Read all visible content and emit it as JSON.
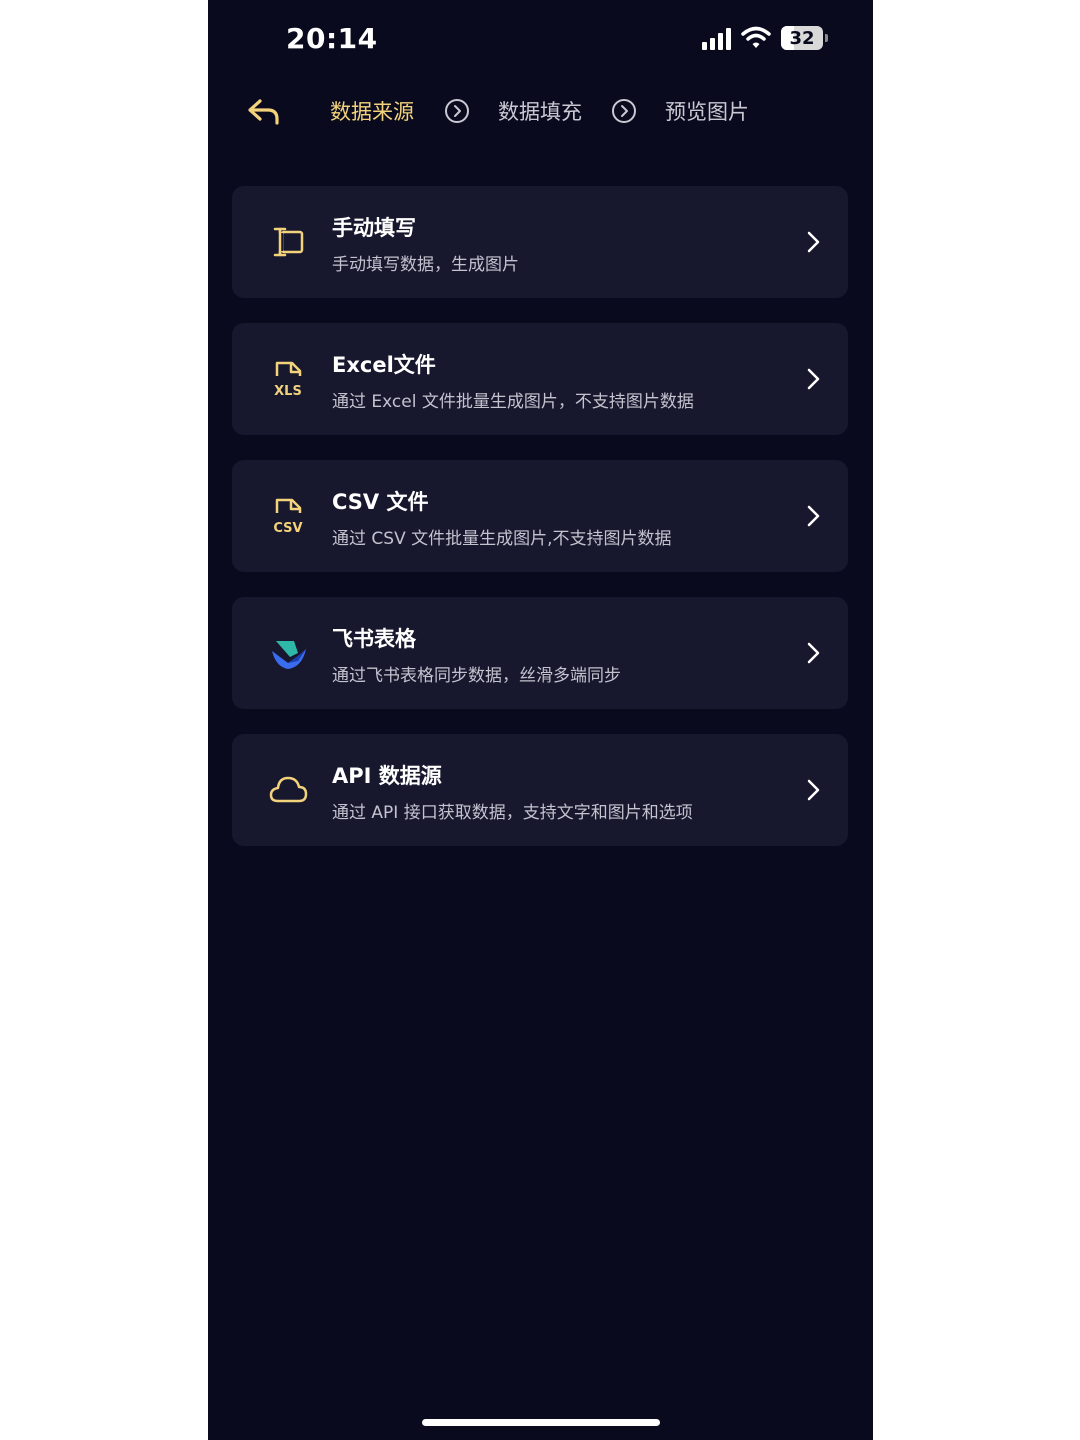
{
  "status_bar": {
    "time": "20:14",
    "battery": "32",
    "battery_level": 0.32,
    "icons": [
      "signal-icon",
      "wifi-icon",
      "battery-icon"
    ]
  },
  "steps": {
    "back_icon": "back-arrow-icon",
    "items": [
      {
        "label": "数据来源",
        "active": true
      },
      {
        "label": "数据填充",
        "active": false
      },
      {
        "label": "预览图片",
        "active": false
      }
    ],
    "separator_icon": "chevron-circle-right-icon"
  },
  "sources": [
    {
      "icon": "text-cursor-icon",
      "title": "手动填写",
      "desc": "手动填写数据，生成图片"
    },
    {
      "icon": "xls-file-icon",
      "icon_text": "XLS",
      "title": "Excel文件",
      "desc": "通过 Excel 文件批量生成图片，不支持图片数据"
    },
    {
      "icon": "csv-file-icon",
      "icon_text": "CSV",
      "title": "CSV 文件",
      "desc": "通过 CSV 文件批量生成图片,不支持图片数据"
    },
    {
      "icon": "feishu-logo-icon",
      "title": "飞书表格",
      "desc": "通过飞书表格同步数据，丝滑多端同步"
    },
    {
      "icon": "cloud-icon",
      "title": "API 数据源",
      "desc": "通过 API 接口获取数据，支持文字和图片和选项"
    }
  ],
  "colors": {
    "background": "#0a0a1f",
    "card": "#17172e",
    "accent": "#f2d27a",
    "text_primary": "#ffffff",
    "text_secondary": "#c3c3cf"
  }
}
